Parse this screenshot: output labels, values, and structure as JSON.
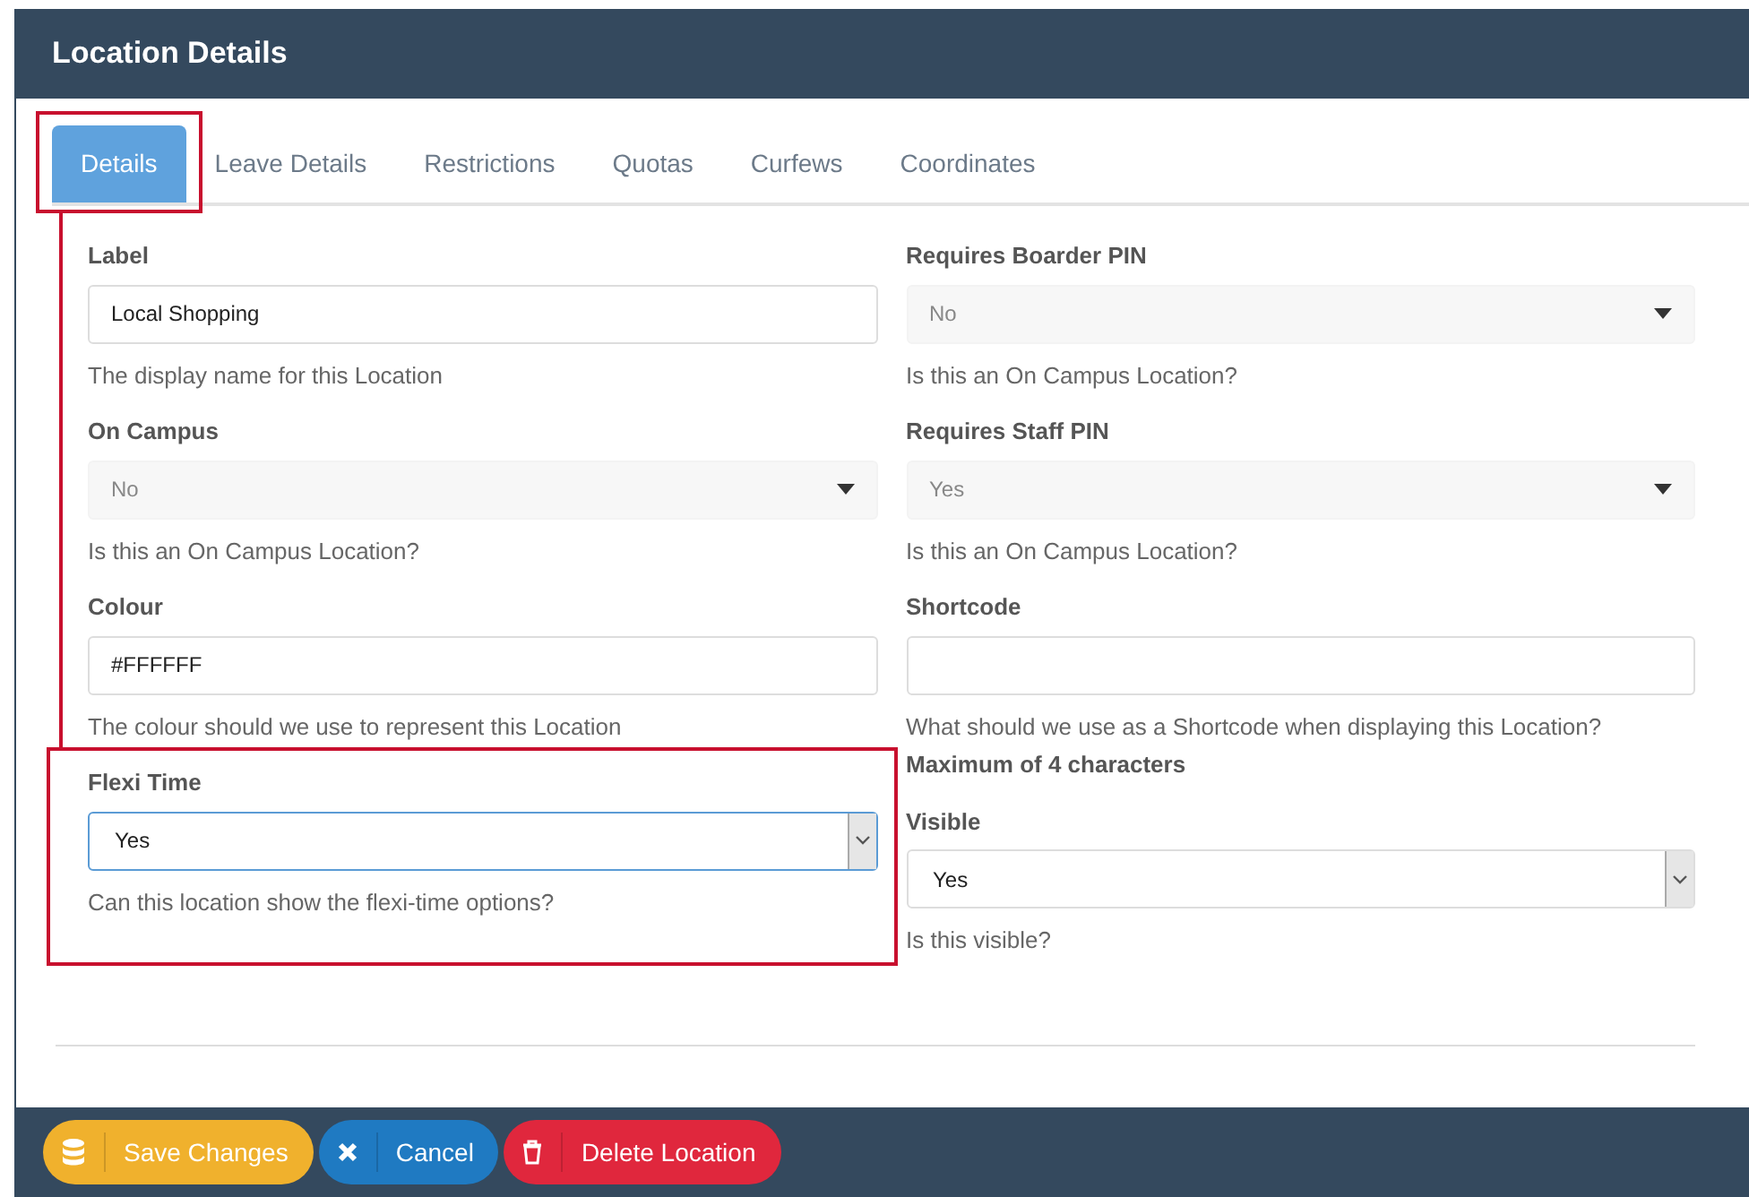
{
  "window": {
    "title": "Location Details"
  },
  "tabs": [
    {
      "label": "Details",
      "selected": true,
      "highlighted": true
    },
    {
      "label": "Leave Details",
      "selected": false,
      "highlighted": false
    },
    {
      "label": "Restrictions",
      "selected": false,
      "highlighted": false
    },
    {
      "label": "Quotas",
      "selected": false,
      "highlighted": false
    },
    {
      "label": "Curfews",
      "selected": false,
      "highlighted": false
    },
    {
      "label": "Coordinates",
      "selected": false,
      "highlighted": false
    }
  ],
  "columns": [
    {
      "fields": [
        {
          "label": "Label",
          "kind": "text",
          "value": "Local Shopping",
          "hint": "The display name for this Location",
          "highlighted": false,
          "focused": false
        },
        {
          "label": "On Campus",
          "kind": "select",
          "disabled": true,
          "value": "No",
          "hint": "Is this an On Campus Location?",
          "highlighted": false,
          "focused": false
        },
        {
          "label": "Colour",
          "kind": "text",
          "value": "#FFFFFF",
          "hint": "The colour should we use to represent this Location",
          "highlighted": false,
          "focused": false
        },
        {
          "label": "Flexi Time",
          "kind": "select",
          "disabled": false,
          "value": "Yes",
          "hint": "Can this location show the flexi-time options?",
          "highlighted": true,
          "focused": true
        }
      ]
    },
    {
      "fields": [
        {
          "label": "Requires Boarder PIN",
          "kind": "select",
          "disabled": true,
          "value": "No",
          "hint": "Is this an On Campus Location?",
          "highlighted": false,
          "focused": false
        },
        {
          "label": "Requires Staff PIN",
          "kind": "select",
          "disabled": true,
          "value": "Yes",
          "hint": "Is this an On Campus Location?",
          "highlighted": false,
          "focused": false
        },
        {
          "label": "Shortcode",
          "kind": "text",
          "hint": "What should we use as a Shortcode when displaying this Location?",
          "note": "Maximum of 4 characters",
          "highlighted": false,
          "focused": false
        },
        {
          "label": "Visible",
          "kind": "select",
          "disabled": false,
          "value": "Yes",
          "hint": "Is this visible?",
          "highlighted": false,
          "focused": false
        }
      ]
    }
  ],
  "buttons": [
    {
      "label": "Save Changes",
      "kind": "save"
    },
    {
      "label": "Cancel",
      "kind": "cancel"
    },
    {
      "label": "Delete Location",
      "kind": "delete"
    }
  ]
}
